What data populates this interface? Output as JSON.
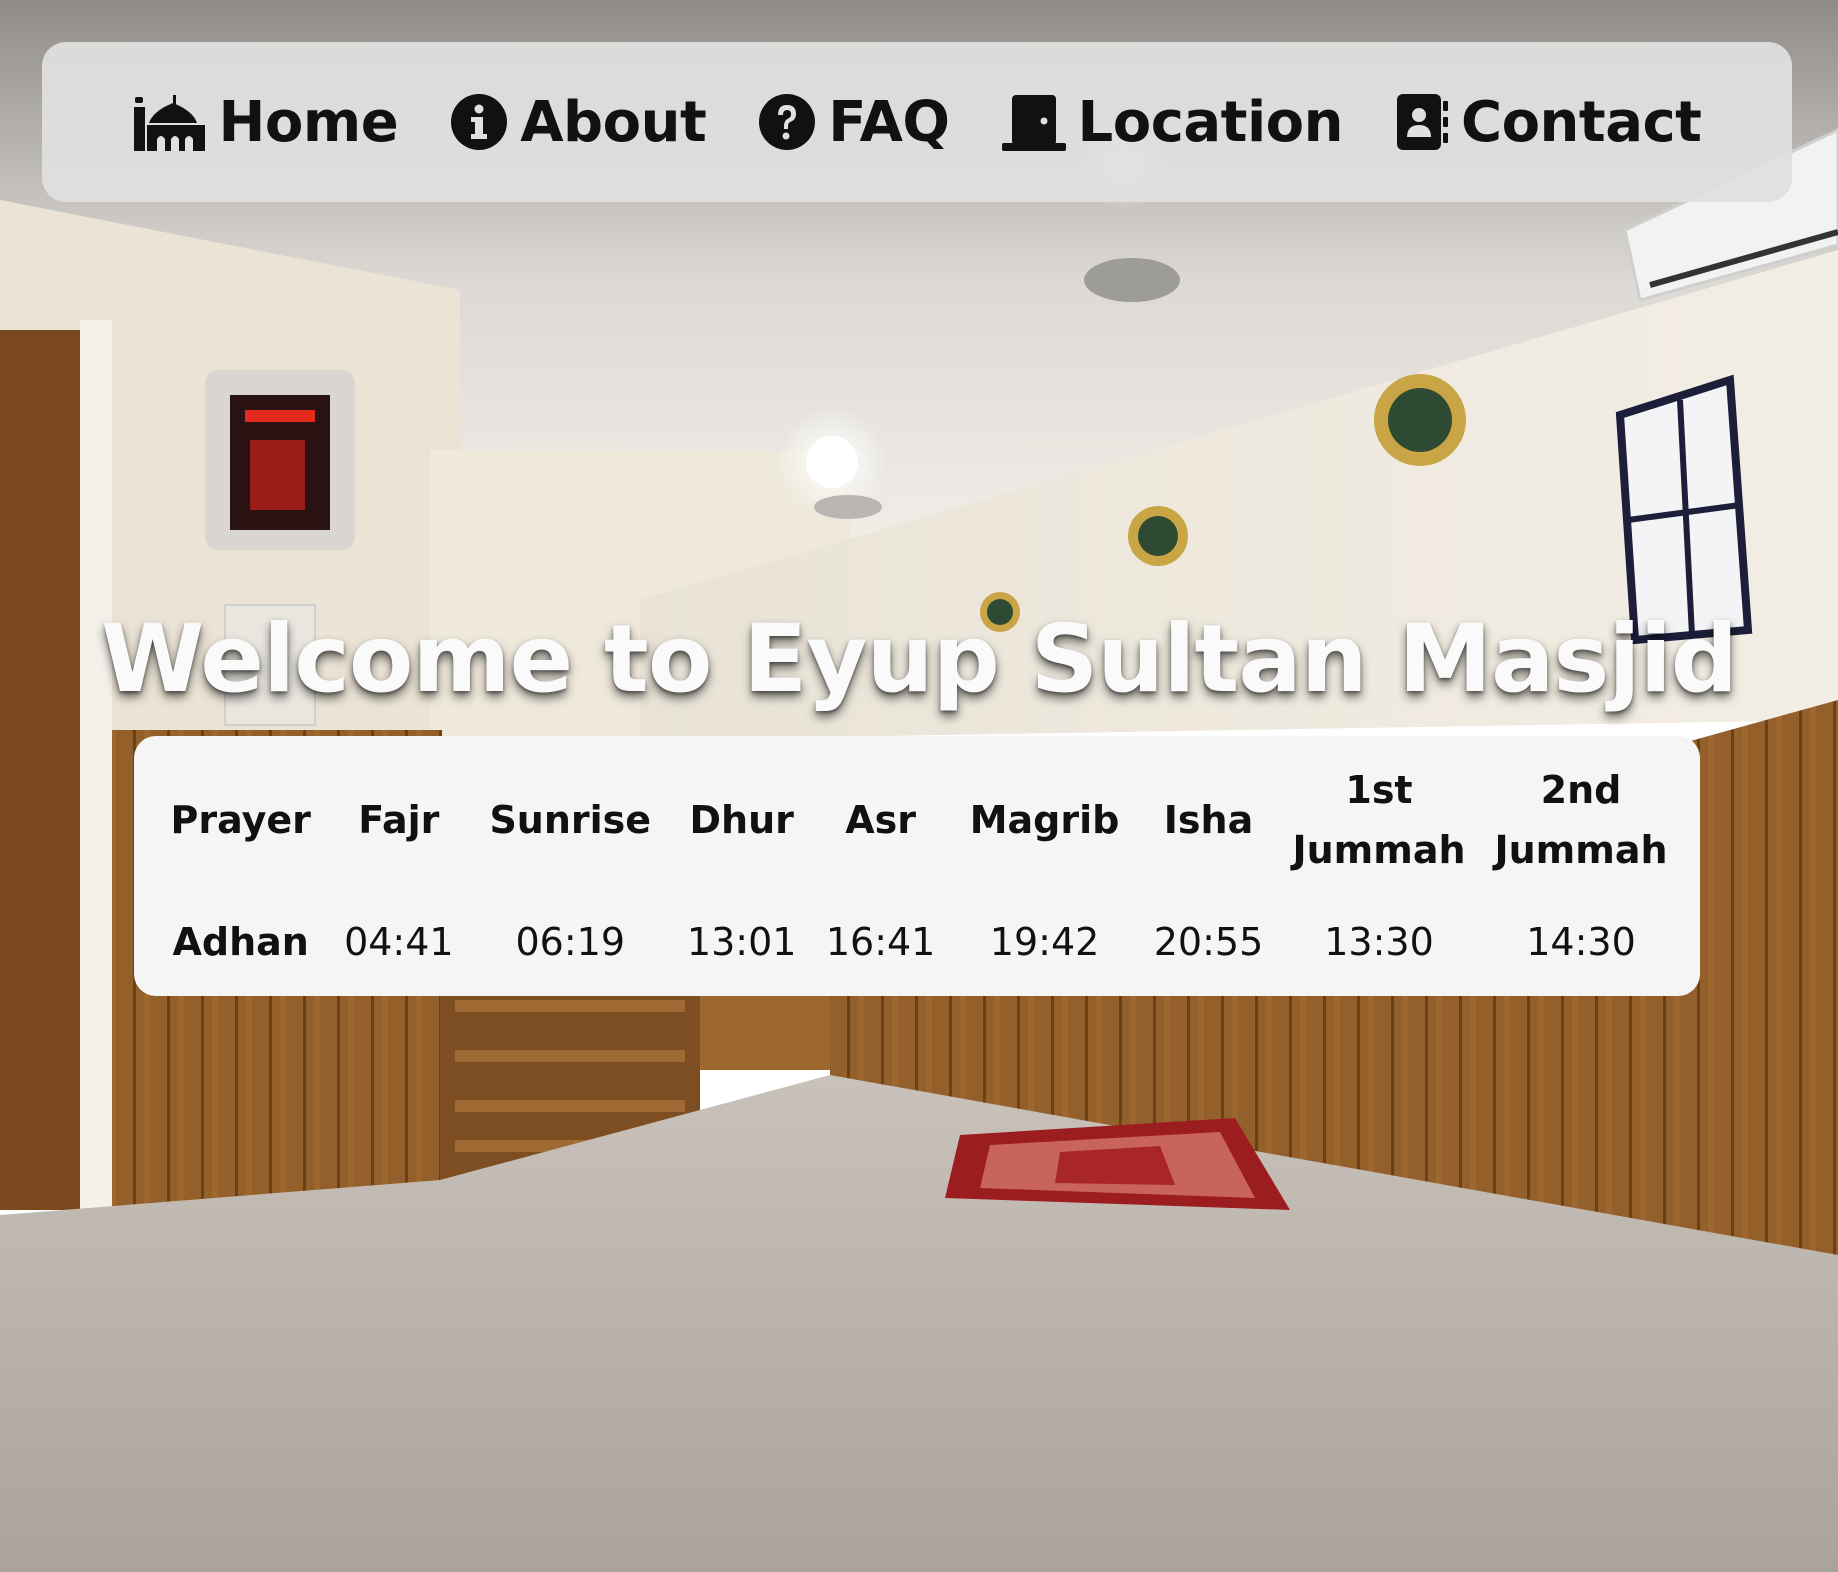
{
  "nav": {
    "items": [
      {
        "label": "Home",
        "icon": "mosque-icon"
      },
      {
        "label": "About",
        "icon": "info-circle-icon"
      },
      {
        "label": "FAQ",
        "icon": "question-circle-icon"
      },
      {
        "label": "Location",
        "icon": "door-icon"
      },
      {
        "label": "Contact",
        "icon": "address-book-icon"
      }
    ]
  },
  "hero": {
    "title": "Welcome to Eyup Sultan Masjid"
  },
  "prayer_table": {
    "headers": [
      "Prayer",
      "Fajr",
      "Sunrise",
      "Dhur",
      "Asr",
      "Magrib",
      "Isha",
      "1st Jummah",
      "2nd Jummah"
    ],
    "rows": [
      {
        "label": "Adhan",
        "times": [
          "04:41",
          "06:19",
          "13:01",
          "16:41",
          "19:42",
          "20:55",
          "13:30",
          "14:30"
        ]
      }
    ]
  },
  "colors": {
    "nav_background": "#e1e0e0",
    "card_background": "#f5f5f5",
    "title_text": "#fafafa",
    "wood_panel": "#8a5a26",
    "carpet": "#bdb7b0",
    "wall": "#e8e2d6"
  }
}
